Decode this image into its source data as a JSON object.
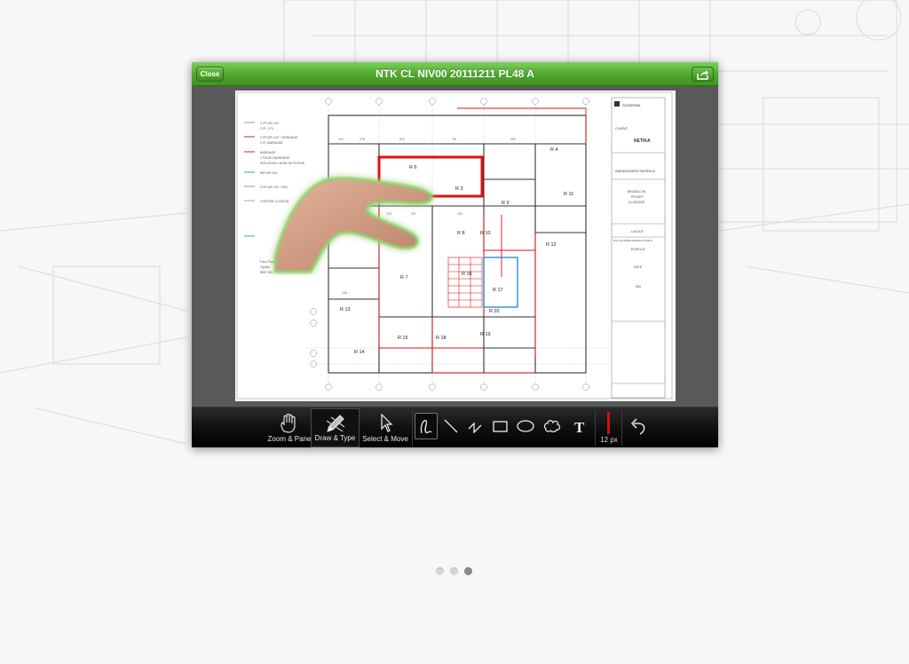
{
  "window": {
    "close_label": "Close",
    "title": "NTK CL NIV00 20111211 PL48 A"
  },
  "drawing": {
    "rooms": [
      "R 3",
      "R 4",
      "R 6",
      "R 7",
      "R 8",
      "R 9",
      "R 10",
      "R 11",
      "R 12",
      "R 13",
      "R 14",
      "R 15",
      "R 16",
      "R 17",
      "R 18",
      "R 19",
      "R 20"
    ],
    "legend": [
      "CYP MS 100",
      "2 PL 1 PL",
      "CYP MS 100 + BARDAGE",
      "2 PL BARDAGE",
      "BARDAGE",
      "2 FACES BARDAGE",
      "ISOLATION LAINE DE ROCHE",
      "WR MS 100",
      "CYP MS 100 + WR",
      "CONTRE CLOISON",
      "Faux Plafond",
      "Gyptal",
      "BBP 200"
    ],
    "title_block": [
      "CLIENT",
      "NETIKA",
      "AMENAGEMENT BUREAUX",
      "BROUILLON",
      "PROJET",
      "CLOISONS",
      "LAYOUT",
      "NTK CL NIV00 20111211 PL48 A",
      "ECHELLE",
      "DATE",
      "IND"
    ]
  },
  "toolbar": {
    "modes": [
      {
        "label": "Zoom & Pane",
        "icon": "hand-icon"
      },
      {
        "label": "Draw & Type",
        "icon": "pencil-icon"
      },
      {
        "label": "Select & Move",
        "icon": "arrow-cursor-icon"
      }
    ],
    "tools": [
      "freehand-icon",
      "line-icon",
      "polyline-icon",
      "rectangle-icon",
      "ellipse-icon",
      "cloud-icon",
      "text-icon"
    ],
    "stroke_color": "#cc1111",
    "stroke_size": "12 px"
  },
  "pager": {
    "pages": 3,
    "current": 3
  },
  "colors": {
    "accent_green": "#4ea62d",
    "markup_red": "#e01010",
    "markup_blue": "#2f8fc9"
  }
}
